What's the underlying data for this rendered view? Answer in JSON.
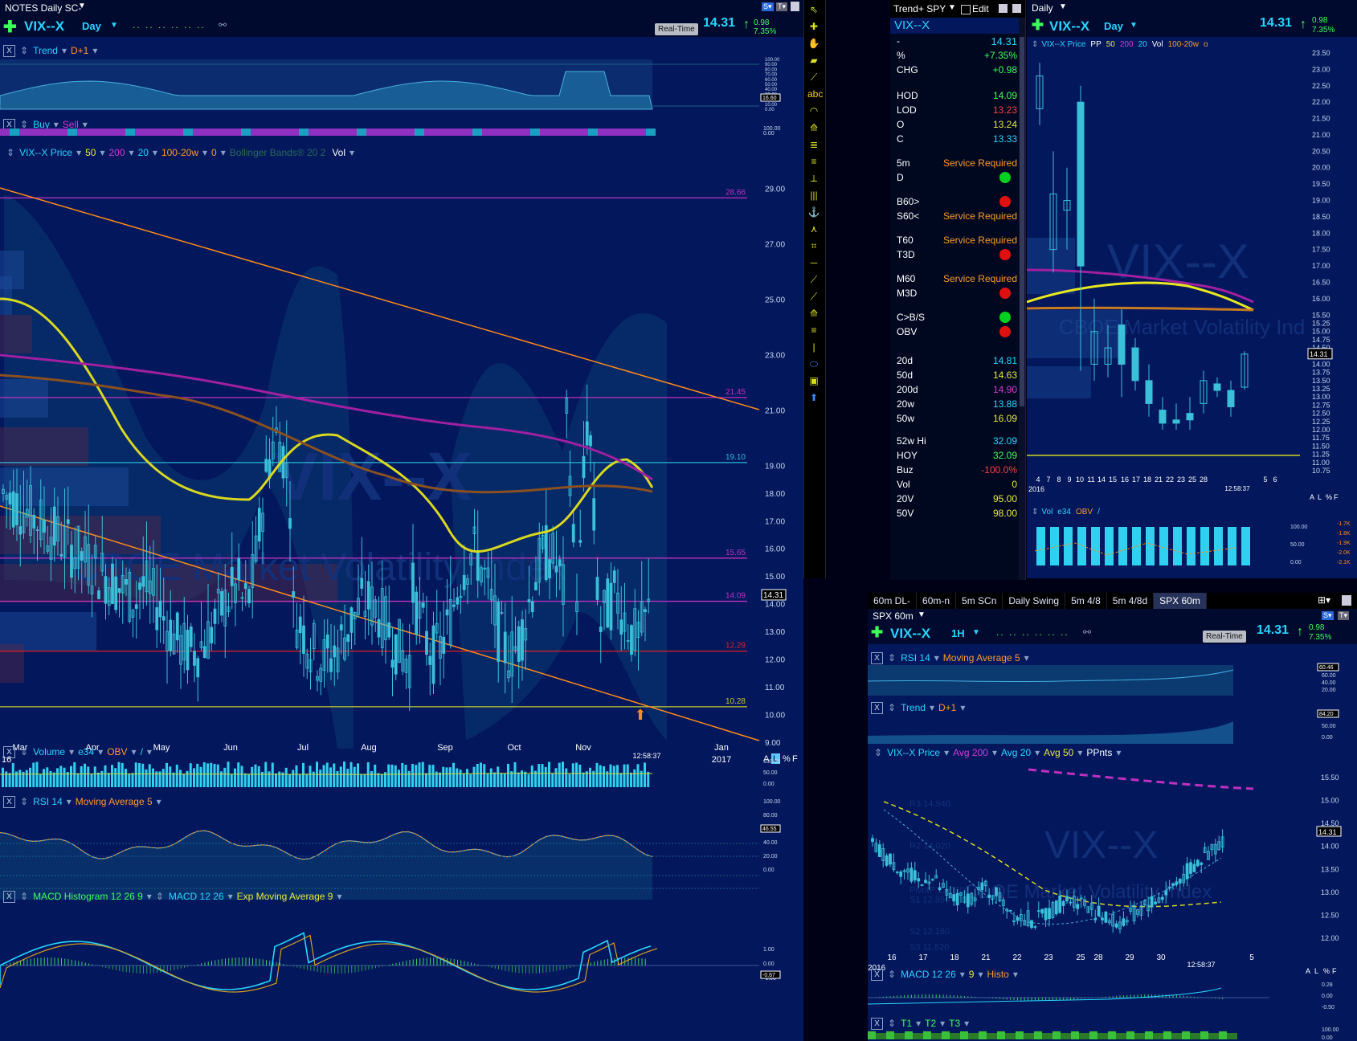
{
  "main": {
    "window_title": "NOTES Daily SC-",
    "symbol": "VIX--X",
    "interval": "Day",
    "realtime_label": "Real-Time",
    "last": "14.31",
    "change": "0.98",
    "change_pct": "7.35%",
    "trend_header": {
      "study": "Trend",
      "param": "D+1"
    },
    "buysell_header": {
      "buy": "Buy",
      "sell": "Sell"
    },
    "price_header": {
      "name": "VIX--X Price",
      "ma1": "50",
      "ma2": "200",
      "ma3": "20",
      "ma4": "100-20w",
      "ma5": "0",
      "bb": "Bollinger Bands® 20 2",
      "vol": "Vol"
    },
    "watermark_symbol": "VIX--X",
    "watermark_name": "CBOE Market Volatility Index",
    "level_labels": [
      "28.66",
      "21.45",
      "19.10",
      "15.65",
      "14.09",
      "12.29",
      "10.28"
    ],
    "current_price_tag": "14.31",
    "y_ticks": [
      "29.00",
      "27.00",
      "25.00",
      "23.00",
      "21.00",
      "19.00",
      "18.00",
      "17.00",
      "16.00",
      "15.00",
      "14.00",
      "13.00",
      "12.00",
      "11.00",
      "10.00",
      "9.00"
    ],
    "x_ticks": [
      "Mar",
      "Apr",
      "May",
      "Jun",
      "Jul",
      "Aug",
      "Sep",
      "Oct",
      "Nov",
      "Jan"
    ],
    "x_year_left": "16",
    "x_year_right": "2017",
    "clock": "12:58:37",
    "scale_modes": [
      "A",
      "L",
      "%",
      "F"
    ],
    "trend_ticks": [
      "100.00",
      "90.00",
      "80.00",
      "70.00",
      "60.00",
      "50.00",
      "40.00",
      "30.00",
      "20.00",
      "10.00",
      "0.00"
    ],
    "trend_tag": "16.60",
    "buysell_ticks": [
      "100.00",
      "0.00"
    ],
    "volume_header": {
      "name": "Volume",
      "ma": "e34",
      "obv": "OBV",
      "line": "/"
    },
    "volume_ticks": [
      "100.00",
      "50.00",
      "0.00"
    ],
    "rsi_header": {
      "name": "RSI 14",
      "ma": "Moving Average 5"
    },
    "rsi_ticks": [
      "100.00",
      "80.00",
      "60.00",
      "40.00",
      "20.00",
      "0.00"
    ],
    "rsi_tag": "46.55",
    "macd_header": {
      "hist": "MACD Histogram 12 26 9",
      "macd": "MACD 12 26",
      "ema": "Exp Moving Average 9"
    },
    "macd_ticks": [
      "1.00",
      "0.00",
      "-1.00"
    ],
    "macd_tag": "-0.67"
  },
  "toolbar": {
    "icons": [
      "arrow-icon",
      "crosshair-icon",
      "hand-icon",
      "eraser-icon",
      "line-icon",
      "text-icon",
      "arc-icon",
      "fan-icon",
      "channel-icon",
      "fib-icon",
      "gann-icon",
      "vertical-lines-icon",
      "anchor-icon",
      "pitchfork-icon",
      "grid-icon",
      "horizontal-line-icon",
      "regression-icon",
      "trendline-icon",
      "fan2-icon",
      "level-icon",
      "vline-icon",
      "ellipse-icon",
      "marker-icon",
      "arrow-up-icon"
    ]
  },
  "quote": {
    "title": "Trend+ SPY",
    "edit_label": "Edit",
    "symbol": "VIX--X",
    "rows": [
      {
        "label": "-",
        "value": "14.31",
        "color": "#26d6ff"
      },
      {
        "label": "%",
        "value": "+7.35%",
        "color": "#3cff5a"
      },
      {
        "label": "CHG",
        "value": "+0.98",
        "color": "#3cff5a"
      },
      {
        "label": "HOD",
        "value": "14.09",
        "color": "#3cff5a"
      },
      {
        "label": "LOD",
        "value": "13.23",
        "color": "#ff4040"
      },
      {
        "label": "O",
        "value": "13.24",
        "color": "#e8e83a"
      },
      {
        "label": "C",
        "value": "13.33",
        "color": "#26d6ff"
      }
    ],
    "signals": [
      {
        "label": "5m",
        "text": "Service Required"
      },
      {
        "label": "D",
        "dot": "#00d020"
      },
      {
        "label": "B60>",
        "dot": "#e01010"
      },
      {
        "label": "S60<",
        "text": "Service Required"
      },
      {
        "label": "T60",
        "text": "Service Required"
      },
      {
        "label": "T3D",
        "dot": "#e01010"
      },
      {
        "label": "M60",
        "text": "Service Required"
      },
      {
        "label": "M3D",
        "dot": "#e01010"
      },
      {
        "label": "C>B/S",
        "dot": "#00d020"
      },
      {
        "label": "OBV",
        "dot": "#e01010"
      }
    ],
    "mas": [
      {
        "label": "20d",
        "value": "14.81",
        "color": "#26d6ff"
      },
      {
        "label": "50d",
        "value": "14.63",
        "color": "#e8e83a"
      },
      {
        "label": "200d",
        "value": "14.90",
        "color": "#d43cd4"
      },
      {
        "label": "20w",
        "value": "13.88",
        "color": "#26d6ff"
      },
      {
        "label": "50w",
        "value": "16.09",
        "color": "#e8e83a"
      }
    ],
    "stats": [
      {
        "label": "52w Hi",
        "value": "32.09",
        "color": "#26d6ff"
      },
      {
        "label": "HOY",
        "value": "32.09",
        "color": "#3cff5a"
      },
      {
        "label": "Buz",
        "value": "-100.0%",
        "color": "#ff4040"
      },
      {
        "label": "Vol",
        "value": "0",
        "color": "#e8e83a"
      },
      {
        "label": "20V",
        "value": "95.00",
        "color": "#e8e83a"
      },
      {
        "label": "50V",
        "value": "98.00",
        "color": "#e8e83a"
      }
    ]
  },
  "daily": {
    "title": "Daily",
    "symbol": "VIX--X",
    "interval": "Day",
    "last": "14.31",
    "change": "0.98",
    "change_pct": "7.35%",
    "header": {
      "name": "VIX--X Price",
      "pp": "PP",
      "ma1": "50",
      "ma2": "200",
      "ma3": "20",
      "vol": "Vol",
      "ma4": "100-20w",
      "o": "o"
    },
    "watermark_symbol": "VIX--X",
    "watermark_name": "CBOE Market Volatility Ind",
    "y_ticks": [
      "23.50",
      "23.00",
      "22.50",
      "22.00",
      "21.50",
      "21.00",
      "20.50",
      "20.00",
      "19.50",
      "19.00",
      "18.50",
      "18.00",
      "17.50",
      "17.00",
      "16.50",
      "16.00",
      "15.50",
      "15.25",
      "15.00",
      "14.75",
      "14.50",
      "14.00",
      "13.75",
      "13.50",
      "13.25",
      "13.00",
      "12.75",
      "12.50",
      "12.25",
      "12.00",
      "11.75",
      "11.50",
      "11.25",
      "11.00",
      "10.75"
    ],
    "price_tag": "14.31",
    "x_ticks": [
      "4",
      "7",
      "8",
      "9",
      "10",
      "11",
      "14",
      "15",
      "16",
      "17",
      "18",
      "21",
      "22",
      "23",
      "25",
      "28",
      "5",
      "6"
    ],
    "x_year": "2016",
    "clock": "12:58:37",
    "vol_header": {
      "name": "Vol",
      "ma": "e34",
      "obv": "OBV",
      "line": "/"
    },
    "vol_ticks": [
      "100.00",
      "50.00",
      "0.00"
    ],
    "obv_ticks": [
      "-1.7K",
      "-1.8K",
      "-1.9K",
      "-2.0K",
      "-2.1K"
    ],
    "scale_modes": [
      "A",
      "L",
      "%",
      "F"
    ]
  },
  "tabs": {
    "items": [
      "60m DL-",
      "60m-n",
      "5m SCn",
      "Daily Swing",
      "5m 4/8",
      "5m 4/8d",
      "SPX 60m"
    ],
    "active_index": 6
  },
  "hourly": {
    "title": "SPX 60m",
    "symbol": "VIX--X",
    "interval": "1H",
    "realtime_label": "Real-Time",
    "last": "14.31",
    "change": "0.98",
    "change_pct": "7.35%",
    "rsi_header": {
      "name": "RSI 14",
      "ma": "Moving Average 5"
    },
    "rsi_ticks": [
      "80.00",
      "60.00",
      "40.00",
      "20.00"
    ],
    "rsi_tag": "60.46",
    "trend_header": {
      "name": "Trend",
      "param": "D+1"
    },
    "trend_ticks": [
      "100.00",
      "50.00",
      "0.00"
    ],
    "trend_tag": "84.20",
    "price_header": {
      "name": "VIX--X Price",
      "ma1": "Avg 200",
      "ma2": "Avg 20",
      "ma3": "Avg 50",
      "pp": "PPnts"
    },
    "pivots": [
      "R3 14.940",
      "R2 14.020",
      "PivotP 13.060",
      "S1 12.850",
      "S2 12.160",
      "S3 11.820"
    ],
    "watermark_symbol": "VIX--X",
    "watermark_name": "CBOE Market Volatility Index",
    "y_ticks": [
      "15.50",
      "15.00",
      "14.50",
      "14.00",
      "13.50",
      "13.00",
      "12.50",
      "12.00"
    ],
    "price_tag": "14.31",
    "x_ticks": [
      "16",
      "17",
      "18",
      "21",
      "22",
      "23",
      "25",
      "28",
      "29",
      "30",
      "5"
    ],
    "x_year": "2016",
    "clock": "12:58:37",
    "macd_header": {
      "name": "MACD 12 26",
      "sig": "9",
      "hist": "Histo"
    },
    "macd_ticks": [
      "0.28",
      "0.00",
      "-0.50"
    ],
    "t_header": {
      "t1": "T1",
      "t2": "T2",
      "t3": "T3"
    },
    "t_ticks": [
      "100.00",
      "0.00"
    ],
    "scale_modes": [
      "A",
      "L",
      "%",
      "F"
    ]
  }
}
